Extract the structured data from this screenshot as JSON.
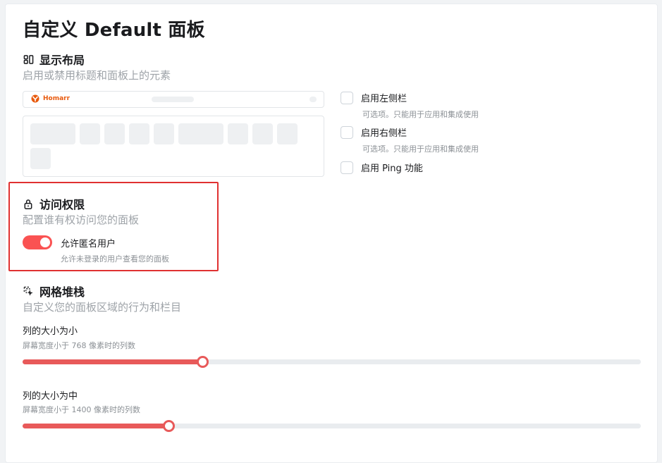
{
  "page": {
    "title": "自定义 Default 面板"
  },
  "layout_section": {
    "title": "显示布局",
    "description": "启用或禁用标题和面板上的元素",
    "preview_logo": "Homarr",
    "options": [
      {
        "label": "启用左侧栏",
        "description": "可选项。只能用于应用和集成使用",
        "checked": false
      },
      {
        "label": "启用右侧栏",
        "description": "可选项。只能用于应用和集成使用",
        "checked": false
      },
      {
        "label": "启用 Ping 功能",
        "description": "",
        "checked": false
      }
    ]
  },
  "access_section": {
    "title": "访问权限",
    "description": "配置谁有权访问您的面板",
    "toggle_label": "允许匿名用户",
    "toggle_description": "允许未登录的用户查看您的面板",
    "toggle_on": true
  },
  "grid_section": {
    "title": "网格堆栈",
    "description": "自定义您的面板区域的行为和栏目",
    "sliders": [
      {
        "label": "列的大小为小",
        "description": "屏幕宽度小于 768 像素时的列数",
        "fraction": 0.29
      },
      {
        "label": "列的大小为中",
        "description": "屏幕宽度小于 1400 像素时的列数",
        "fraction": 0.235
      }
    ]
  },
  "colors": {
    "accent": "#fa5252",
    "highlight": "#e03131",
    "logo": "#e8590c"
  }
}
